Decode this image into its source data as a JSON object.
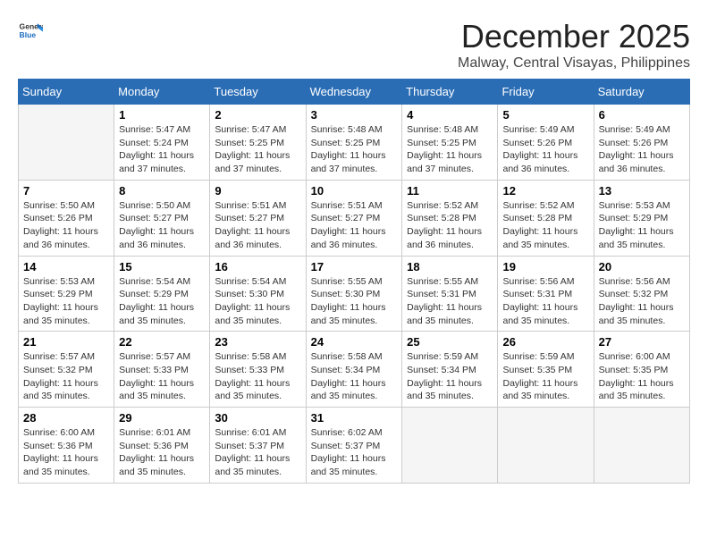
{
  "header": {
    "logo_general": "General",
    "logo_blue": "Blue",
    "month": "December 2025",
    "location": "Malway, Central Visayas, Philippines"
  },
  "weekdays": [
    "Sunday",
    "Monday",
    "Tuesday",
    "Wednesday",
    "Thursday",
    "Friday",
    "Saturday"
  ],
  "weeks": [
    [
      {
        "day": "",
        "info": ""
      },
      {
        "day": "1",
        "info": "Sunrise: 5:47 AM\nSunset: 5:24 PM\nDaylight: 11 hours and 37 minutes."
      },
      {
        "day": "2",
        "info": "Sunrise: 5:47 AM\nSunset: 5:25 PM\nDaylight: 11 hours and 37 minutes."
      },
      {
        "day": "3",
        "info": "Sunrise: 5:48 AM\nSunset: 5:25 PM\nDaylight: 11 hours and 37 minutes."
      },
      {
        "day": "4",
        "info": "Sunrise: 5:48 AM\nSunset: 5:25 PM\nDaylight: 11 hours and 37 minutes."
      },
      {
        "day": "5",
        "info": "Sunrise: 5:49 AM\nSunset: 5:26 PM\nDaylight: 11 hours and 36 minutes."
      },
      {
        "day": "6",
        "info": "Sunrise: 5:49 AM\nSunset: 5:26 PM\nDaylight: 11 hours and 36 minutes."
      }
    ],
    [
      {
        "day": "7",
        "info": "Sunrise: 5:50 AM\nSunset: 5:26 PM\nDaylight: 11 hours and 36 minutes."
      },
      {
        "day": "8",
        "info": "Sunrise: 5:50 AM\nSunset: 5:27 PM\nDaylight: 11 hours and 36 minutes."
      },
      {
        "day": "9",
        "info": "Sunrise: 5:51 AM\nSunset: 5:27 PM\nDaylight: 11 hours and 36 minutes."
      },
      {
        "day": "10",
        "info": "Sunrise: 5:51 AM\nSunset: 5:27 PM\nDaylight: 11 hours and 36 minutes."
      },
      {
        "day": "11",
        "info": "Sunrise: 5:52 AM\nSunset: 5:28 PM\nDaylight: 11 hours and 36 minutes."
      },
      {
        "day": "12",
        "info": "Sunrise: 5:52 AM\nSunset: 5:28 PM\nDaylight: 11 hours and 35 minutes."
      },
      {
        "day": "13",
        "info": "Sunrise: 5:53 AM\nSunset: 5:29 PM\nDaylight: 11 hours and 35 minutes."
      }
    ],
    [
      {
        "day": "14",
        "info": "Sunrise: 5:53 AM\nSunset: 5:29 PM\nDaylight: 11 hours and 35 minutes."
      },
      {
        "day": "15",
        "info": "Sunrise: 5:54 AM\nSunset: 5:29 PM\nDaylight: 11 hours and 35 minutes."
      },
      {
        "day": "16",
        "info": "Sunrise: 5:54 AM\nSunset: 5:30 PM\nDaylight: 11 hours and 35 minutes."
      },
      {
        "day": "17",
        "info": "Sunrise: 5:55 AM\nSunset: 5:30 PM\nDaylight: 11 hours and 35 minutes."
      },
      {
        "day": "18",
        "info": "Sunrise: 5:55 AM\nSunset: 5:31 PM\nDaylight: 11 hours and 35 minutes."
      },
      {
        "day": "19",
        "info": "Sunrise: 5:56 AM\nSunset: 5:31 PM\nDaylight: 11 hours and 35 minutes."
      },
      {
        "day": "20",
        "info": "Sunrise: 5:56 AM\nSunset: 5:32 PM\nDaylight: 11 hours and 35 minutes."
      }
    ],
    [
      {
        "day": "21",
        "info": "Sunrise: 5:57 AM\nSunset: 5:32 PM\nDaylight: 11 hours and 35 minutes."
      },
      {
        "day": "22",
        "info": "Sunrise: 5:57 AM\nSunset: 5:33 PM\nDaylight: 11 hours and 35 minutes."
      },
      {
        "day": "23",
        "info": "Sunrise: 5:58 AM\nSunset: 5:33 PM\nDaylight: 11 hours and 35 minutes."
      },
      {
        "day": "24",
        "info": "Sunrise: 5:58 AM\nSunset: 5:34 PM\nDaylight: 11 hours and 35 minutes."
      },
      {
        "day": "25",
        "info": "Sunrise: 5:59 AM\nSunset: 5:34 PM\nDaylight: 11 hours and 35 minutes."
      },
      {
        "day": "26",
        "info": "Sunrise: 5:59 AM\nSunset: 5:35 PM\nDaylight: 11 hours and 35 minutes."
      },
      {
        "day": "27",
        "info": "Sunrise: 6:00 AM\nSunset: 5:35 PM\nDaylight: 11 hours and 35 minutes."
      }
    ],
    [
      {
        "day": "28",
        "info": "Sunrise: 6:00 AM\nSunset: 5:36 PM\nDaylight: 11 hours and 35 minutes."
      },
      {
        "day": "29",
        "info": "Sunrise: 6:01 AM\nSunset: 5:36 PM\nDaylight: 11 hours and 35 minutes."
      },
      {
        "day": "30",
        "info": "Sunrise: 6:01 AM\nSunset: 5:37 PM\nDaylight: 11 hours and 35 minutes."
      },
      {
        "day": "31",
        "info": "Sunrise: 6:02 AM\nSunset: 5:37 PM\nDaylight: 11 hours and 35 minutes."
      },
      {
        "day": "",
        "info": ""
      },
      {
        "day": "",
        "info": ""
      },
      {
        "day": "",
        "info": ""
      }
    ]
  ]
}
